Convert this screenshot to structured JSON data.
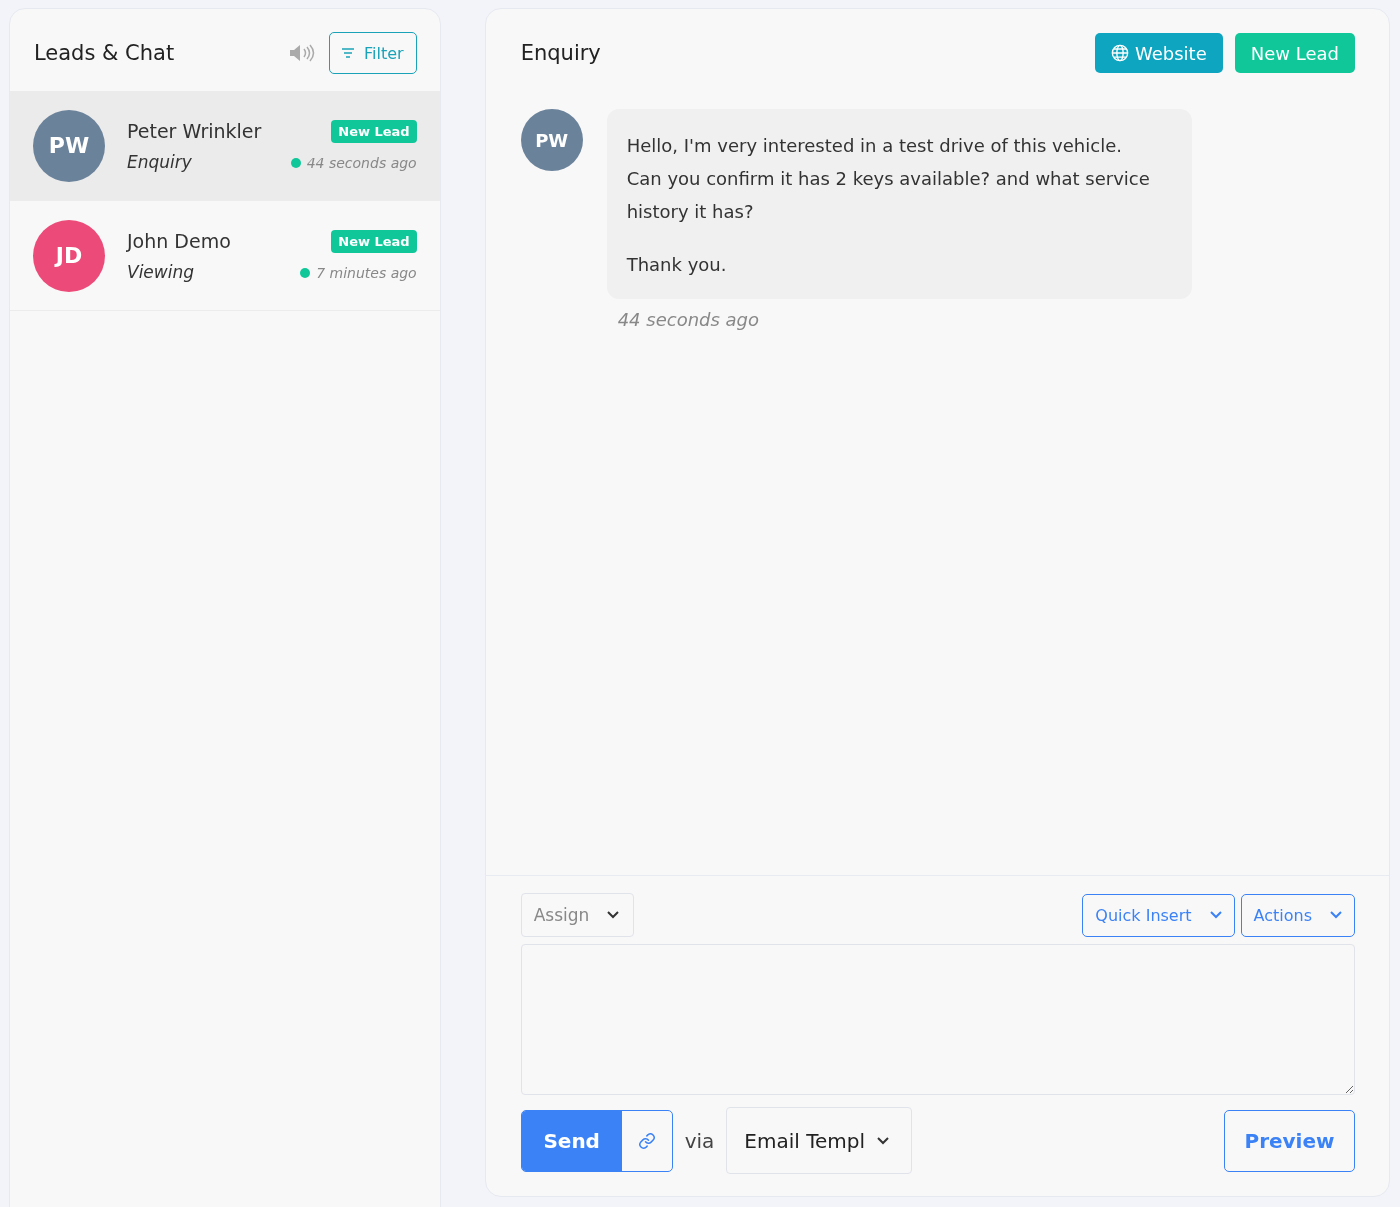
{
  "sidebar": {
    "title": "Leads & Chat",
    "filter_button": "Filter",
    "leads": [
      {
        "initials": "PW",
        "color": "#6b829b",
        "name": "Peter Wrinkler",
        "subtitle": "Enquiry",
        "badge": "New Lead",
        "time": "44 seconds ago",
        "selected": true
      },
      {
        "initials": "JD",
        "color": "#ec4a78",
        "name": "John Demo",
        "subtitle": "Viewing",
        "badge": "New Lead",
        "time": "7 minutes ago",
        "selected": false
      }
    ]
  },
  "conversation": {
    "title": "Enquiry",
    "buttons": [
      {
        "label": "Website",
        "kind": "source"
      },
      {
        "label": "New Lead",
        "kind": "status"
      }
    ],
    "messages": [
      {
        "initials": "PW",
        "paragraphs": [
          "Hello, I'm very interested in a test drive of this vehicle. Can you confirm it has 2 keys available? and what service history it has?",
          "Thank you."
        ],
        "time": "44 seconds ago"
      }
    ]
  },
  "composer": {
    "assign": "Assign",
    "quick_insert": "Quick Insert",
    "actions": "Actions",
    "send": "Send",
    "via": "via",
    "template": "Email Templ",
    "preview": "Preview"
  }
}
